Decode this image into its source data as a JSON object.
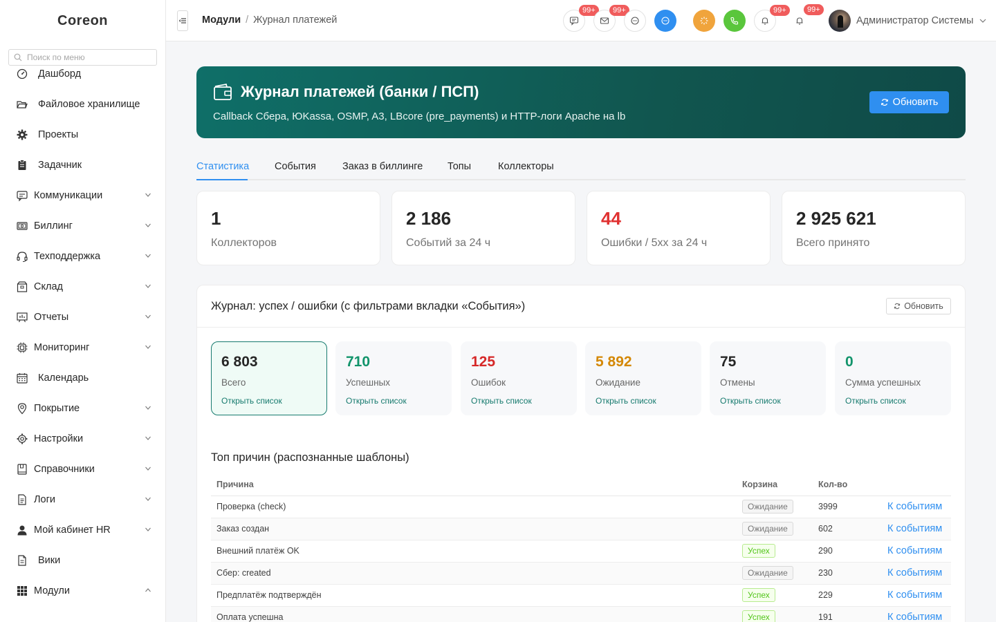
{
  "app": {
    "logo": "Coreon"
  },
  "sidebar": {
    "search_placeholder": "Поиск по меню",
    "items": [
      {
        "label": "Дашборд",
        "icon": "dashboard-icon",
        "expandable": false
      },
      {
        "label": "Файловое хранилище",
        "icon": "folder-open-icon",
        "expandable": false
      },
      {
        "label": "Проекты",
        "icon": "gear-solid-icon",
        "expandable": false
      },
      {
        "label": "Задачник",
        "icon": "clipboard-icon",
        "expandable": false
      },
      {
        "label": "Коммуникации",
        "icon": "message-icon",
        "expandable": true
      },
      {
        "label": "Биллинг",
        "icon": "billing-icon",
        "expandable": true
      },
      {
        "label": "Техподдержка",
        "icon": "headset-icon",
        "expandable": true
      },
      {
        "label": "Склад",
        "icon": "box-icon",
        "expandable": true
      },
      {
        "label": "Отчеты",
        "icon": "report-icon",
        "expandable": true
      },
      {
        "label": "Мониторинг",
        "icon": "chip-icon",
        "expandable": true
      },
      {
        "label": "Календарь",
        "icon": "calendar-icon",
        "expandable": false
      },
      {
        "label": "Покрытие",
        "icon": "location-icon",
        "expandable": true
      },
      {
        "label": "Настройки",
        "icon": "settings-icon",
        "expandable": true
      },
      {
        "label": "Справочники",
        "icon": "book-icon",
        "expandable": true
      },
      {
        "label": "Логи",
        "icon": "document-icon",
        "expandable": true
      },
      {
        "label": "Мой кабинет HR",
        "icon": "user-icon",
        "expandable": true
      },
      {
        "label": "Вики",
        "icon": "file-text-icon",
        "expandable": false
      },
      {
        "label": "Модули",
        "icon": "grid-icon",
        "expandable": true,
        "open": true
      }
    ]
  },
  "header": {
    "breadcrumb": {
      "root": "Модули",
      "separator": "/",
      "current": "Журнал платежей"
    },
    "badges": {
      "chat": "99+",
      "mail": "99+",
      "bell1": "99+",
      "bell2": "99+"
    },
    "user_name": "Администратор Системы",
    "colors": {
      "blue": "#2f8ff0",
      "orange": "#f0a43c",
      "green": "#5ac63c",
      "badge": "#f05c5c"
    }
  },
  "banner": {
    "title": "Журнал платежей (банки / ПСП)",
    "subtitle": "Callback Сбера, ЮKassa, OSMP, A3, LBcore (pre_payments) и HTTP-логи Apache на lb",
    "refresh_label": "Обновить"
  },
  "tabs": [
    {
      "label": "Статистика",
      "active": true
    },
    {
      "label": "События"
    },
    {
      "label": "Заказ в биллинге"
    },
    {
      "label": "Топы"
    },
    {
      "label": "Коллекторы"
    }
  ],
  "stats": [
    {
      "value": "1",
      "label": "Коллекторов",
      "color": "#262626"
    },
    {
      "value": "2 186",
      "label": "Событий за 24 ч",
      "color": "#262626"
    },
    {
      "value": "44",
      "label": "Ошибки / 5xx за 24 ч",
      "color": "#e03131"
    },
    {
      "value": "2 925 621",
      "label": "Всего принято",
      "color": "#262626"
    }
  ],
  "journal": {
    "title": "Журнал: успех / ошибки (с фильтрами вкладки «События»)",
    "refresh_label": "Обновить",
    "cards": [
      {
        "value": "6 803",
        "label": "Всего",
        "link": "Открыть список",
        "color": "#262626",
        "active": true
      },
      {
        "value": "710",
        "label": "Успешных",
        "link": "Открыть список",
        "color": "#12946b"
      },
      {
        "value": "125",
        "label": "Ошибок",
        "link": "Открыть список",
        "color": "#d62828"
      },
      {
        "value": "5 892",
        "label": "Ожидание",
        "link": "Открыть список",
        "color": "#d48806"
      },
      {
        "value": "75",
        "label": "Отмены",
        "link": "Открыть список",
        "color": "#262626"
      },
      {
        "value": "0",
        "label": "Сумма успешных",
        "link": "Открыть список",
        "color": "#12946b"
      }
    ]
  },
  "top_reasons": {
    "title": "Топ причин (распознанные шаблоны)",
    "columns": [
      "Причина",
      "Корзина",
      "Кол-во"
    ],
    "link_label": "К событиям",
    "rows": [
      {
        "reason": "Проверка (check)",
        "bucket": "Ожидание",
        "bucket_type": "wait",
        "count": "3999"
      },
      {
        "reason": "Заказ создан",
        "bucket": "Ожидание",
        "bucket_type": "wait",
        "count": "602"
      },
      {
        "reason": "Внешний платёж OK",
        "bucket": "Успех",
        "bucket_type": "ok",
        "count": "290"
      },
      {
        "reason": "Сбер: created",
        "bucket": "Ожидание",
        "bucket_type": "wait",
        "count": "230"
      },
      {
        "reason": "Предплатёж подтверждён",
        "bucket": "Успех",
        "bucket_type": "ok",
        "count": "229"
      },
      {
        "reason": "Оплата успешна",
        "bucket": "Успех",
        "bucket_type": "ok",
        "count": "191"
      }
    ]
  }
}
